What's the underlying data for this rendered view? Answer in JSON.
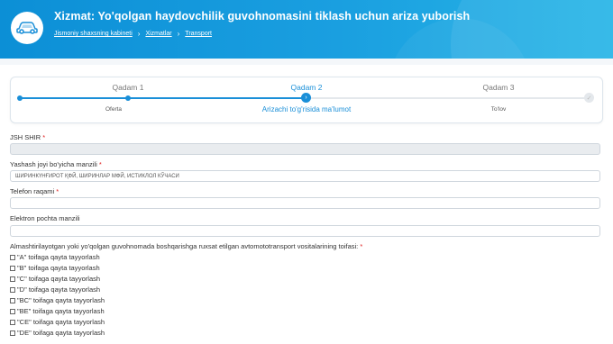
{
  "header": {
    "title": "Xizmat: Yo'qolgan haydovchilik guvohnomasini tiklash uchun ariza yuborish",
    "breadcrumb": [
      "Jismoniy shaxsning kabineti",
      "Xizmatlar",
      "Transport"
    ]
  },
  "stepper": {
    "steps": [
      {
        "title": "Qadam 1",
        "label": "Oferta"
      },
      {
        "title": "Qadam 2",
        "label": "Arizachi to'g'risida ma'lumot"
      },
      {
        "title": "Qadam 3",
        "label": "To'lov"
      }
    ],
    "current_step_icon": "chevron-right-icon",
    "final_step_icon": "check-icon"
  },
  "form": {
    "jshshir_label": "JSH SHIR",
    "address_label": "Yashash joyi bo'yicha manzili",
    "address_value": "ШИРИНКҮНҒИРОТ ҚФЙ, ШИРИНЛАР МФЙ, ИСТИКЛОЛ КЎЧАСИ",
    "phone_label": "Telefon raqami",
    "email_label": "Elektron pochta manzili",
    "category_question": "Almashtirilayotgan yoki yo'qolgan guvohnomada boshqarishga ruxsat etilgan avtomototransport vositalarining toifasi:",
    "required_mark": "*"
  },
  "categories": [
    "\"A\" toifaga qayta tayyorlash",
    "\"B\" toifaga qayta tayyorlash",
    "\"C\" toifaga qayta tayyorlash",
    "\"D\" toifaga qayta tayyorlash",
    "\"BC\" toifaga qayta tayyorlash",
    "\"BE\" toifaga qayta tayyorlash",
    "\"CE\" toifaga qayta tayyorlash",
    "\"DE\" toifaga qayta tayyorlash"
  ],
  "colors": {
    "accent": "#1a8fd8",
    "required": "#e02020"
  }
}
